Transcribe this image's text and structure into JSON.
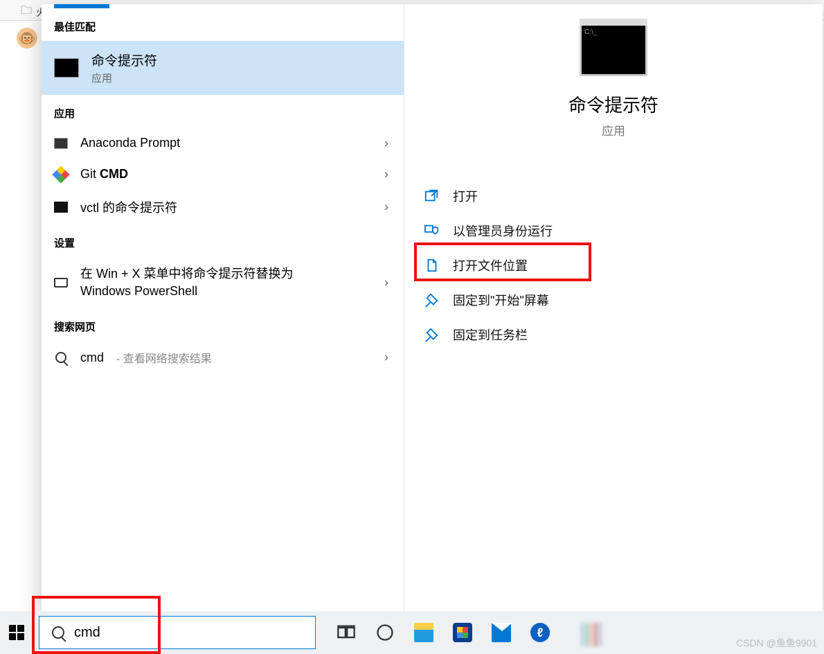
{
  "browser": {
    "tab_label": "火狐"
  },
  "panel": {
    "sections": {
      "best": "最佳匹配",
      "apps": "应用",
      "settings": "设置",
      "web": "搜索网页"
    },
    "best_match": {
      "title": "命令提示符",
      "subtitle": "应用"
    },
    "apps": [
      {
        "label": "Anaconda Prompt"
      },
      {
        "label_prefix": "Git ",
        "label_bold": "CMD"
      },
      {
        "label": "vctl 的命令提示符"
      }
    ],
    "settings_item": "在 Win + X 菜单中将命令提示符替换为 Windows PowerShell",
    "web_item": {
      "term": "cmd",
      "hint": " - 查看网络搜索结果"
    }
  },
  "preview": {
    "title": "命令提示符",
    "subtitle": "应用",
    "actions": {
      "open": "打开",
      "admin": "以管理员身份运行",
      "location": "打开文件位置",
      "pin_start": "固定到\"开始\"屏幕",
      "pin_taskbar": "固定到任务栏"
    }
  },
  "taskbar": {
    "search_value": "cmd",
    "browser_letter": "ℓ"
  },
  "watermark": "CSDN @鱼鱼9901",
  "colors": {
    "accent": "#0078d4",
    "highlight": "#cce4f7",
    "red": "#e11"
  }
}
